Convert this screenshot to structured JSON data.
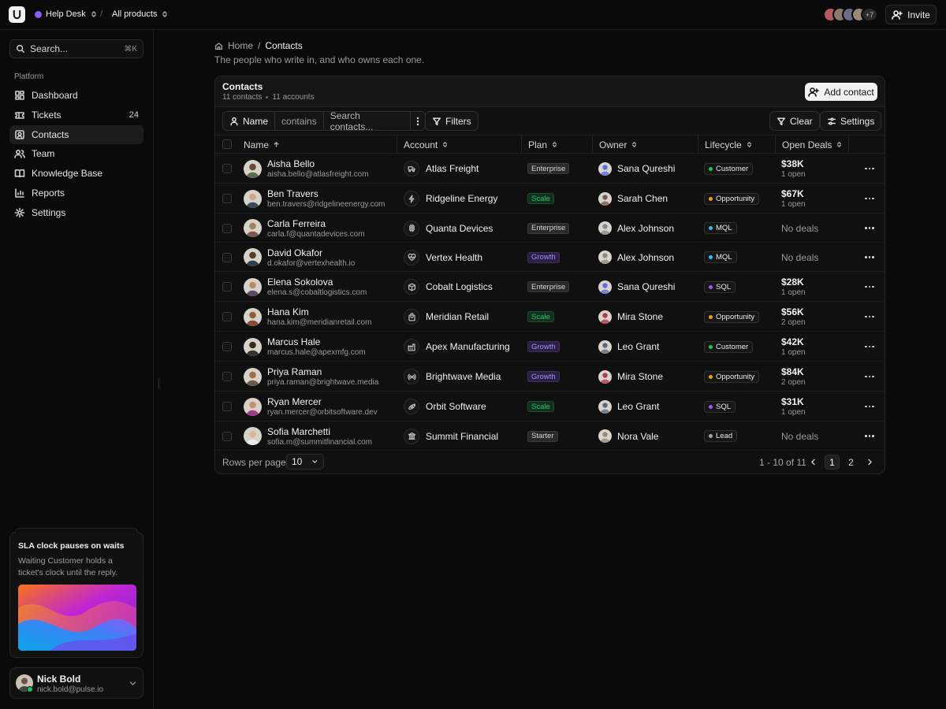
{
  "topbar": {
    "workspace": "Help Desk",
    "product": "All products",
    "separator": "/",
    "avatars_more": "+7",
    "invite_label": "Invite",
    "workspace_color": "#8b5cf6"
  },
  "sidebar": {
    "search_placeholder": "Search...",
    "search_shortcut": "⌘K",
    "section_label": "Platform",
    "items": [
      {
        "label": "Dashboard",
        "icon": "dashboard-icon"
      },
      {
        "label": "Tickets",
        "icon": "ticket-icon",
        "count": "24"
      },
      {
        "label": "Contacts",
        "icon": "contact-icon",
        "active": true
      },
      {
        "label": "Team",
        "icon": "team-icon"
      },
      {
        "label": "Knowledge Base",
        "icon": "book-icon"
      },
      {
        "label": "Reports",
        "icon": "chart-icon"
      },
      {
        "label": "Settings",
        "icon": "gear-icon"
      }
    ],
    "promo": {
      "title": "SLA clock pauses on waits",
      "text": "Waiting Customer holds a ticket's clock until the reply."
    },
    "user": {
      "name": "Nick Bold",
      "email": "nick.bold@pulse.io"
    }
  },
  "breadcrumb": {
    "home": "Home",
    "separator": "/",
    "current": "Contacts"
  },
  "subtitle": "The people who write in, and who owns each one.",
  "card": {
    "title": "Contacts",
    "contacts_count": "11 contacts",
    "accounts_count": "11 accounts",
    "add_label": "Add contact"
  },
  "toolbar": {
    "filter_field": "Name",
    "filter_op": "contains",
    "filter_placeholder": "Search contacts...",
    "filters_label": "Filters",
    "clear_label": "Clear",
    "settings_label": "Settings"
  },
  "columns": {
    "name": "Name",
    "account": "Account",
    "plan": "Plan",
    "owner": "Owner",
    "lifecycle": "Lifecycle",
    "deals": "Open Deals"
  },
  "plan_colors": {
    "Enterprise": "#d4d4d4",
    "Scale": "#22c55e",
    "Growth": "#a78bfa",
    "Starter": "#d4d4d4"
  },
  "lifecycle_colors": {
    "Customer": "#22c55e",
    "Opportunity": "#f59e0b",
    "MQL": "#38bdf8",
    "SQL": "#a855f7",
    "Lead": "#a3a3a3"
  },
  "rows": [
    {
      "name": "Aisha Bello",
      "email": "aisha.bello@atlasfreight.com",
      "account": "Atlas Freight",
      "account_icon": "truck-icon",
      "plan": "Enterprise",
      "owner": "Sana Qureshi",
      "lifecycle": "Customer",
      "deal": "$38K",
      "deal_sub": "1 open"
    },
    {
      "name": "Ben Travers",
      "email": "ben.travers@ridgelineenergy.com",
      "account": "Ridgeline Energy",
      "account_icon": "bolt-icon",
      "plan": "Scale",
      "owner": "Sarah Chen",
      "lifecycle": "Opportunity",
      "deal": "$67K",
      "deal_sub": "1 open"
    },
    {
      "name": "Carla Ferreira",
      "email": "carla.f@quantadevices.com",
      "account": "Quanta Devices",
      "account_icon": "chip-icon",
      "plan": "Enterprise",
      "owner": "Alex Johnson",
      "lifecycle": "MQL",
      "deal": "",
      "deal_sub": "",
      "no_deal": "No deals"
    },
    {
      "name": "David Okafor",
      "email": "d.okafor@vertexhealth.io",
      "account": "Vertex Health",
      "account_icon": "heart-pulse-icon",
      "plan": "Growth",
      "owner": "Alex Johnson",
      "lifecycle": "MQL",
      "deal": "",
      "deal_sub": "",
      "no_deal": "No deals"
    },
    {
      "name": "Elena Sokolova",
      "email": "elena.s@cobaltlogistics.com",
      "account": "Cobalt Logistics",
      "account_icon": "box-icon",
      "plan": "Enterprise",
      "owner": "Sana Qureshi",
      "lifecycle": "SQL",
      "deal": "$28K",
      "deal_sub": "1 open"
    },
    {
      "name": "Hana Kim",
      "email": "hana.kim@meridianretail.com",
      "account": "Meridian Retail",
      "account_icon": "bag-icon",
      "plan": "Scale",
      "owner": "Mira Stone",
      "lifecycle": "Opportunity",
      "deal": "$56K",
      "deal_sub": "2 open"
    },
    {
      "name": "Marcus Hale",
      "email": "marcus.hale@apexmfg.com",
      "account": "Apex Manufacturing",
      "account_icon": "factory-icon",
      "plan": "Growth",
      "owner": "Leo Grant",
      "lifecycle": "Customer",
      "deal": "$42K",
      "deal_sub": "1 open"
    },
    {
      "name": "Priya Raman",
      "email": "priya.raman@brightwave.media",
      "account": "Brightwave Media",
      "account_icon": "broadcast-icon",
      "plan": "Growth",
      "owner": "Mira Stone",
      "lifecycle": "Opportunity",
      "deal": "$84K",
      "deal_sub": "2 open"
    },
    {
      "name": "Ryan Mercer",
      "email": "ryan.mercer@orbitsoftware.dev",
      "account": "Orbit Software",
      "account_icon": "orbit-icon",
      "plan": "Scale",
      "owner": "Leo Grant",
      "lifecycle": "SQL",
      "deal": "$31K",
      "deal_sub": "1 open"
    },
    {
      "name": "Sofia Marchetti",
      "email": "sofia.m@summitfinancial.com",
      "account": "Summit Financial",
      "account_icon": "bank-icon",
      "plan": "Starter",
      "owner": "Nora Vale",
      "lifecycle": "Lead",
      "deal": "",
      "deal_sub": "",
      "no_deal": "No deals"
    }
  ],
  "pagination": {
    "rows_label": "Rows per page",
    "rows_value": "10",
    "range": "1 - 10 of 11",
    "pages": [
      "1",
      "2"
    ]
  }
}
